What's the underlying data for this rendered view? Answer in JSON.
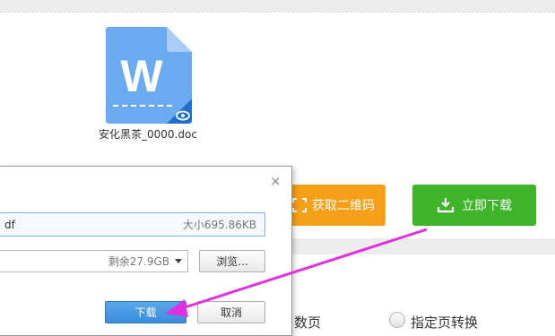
{
  "file": {
    "name": "安化黑茶_0000.doc",
    "icon_letter": "W"
  },
  "actions": {
    "qr_label": "获取二维码",
    "download_label": "立即下载"
  },
  "options": {
    "option1_label": "数页",
    "option2_label": "指定页转换"
  },
  "dialog": {
    "filename_partial": "df",
    "size_text": "大小695.86KB",
    "space_text": "剩余27.9GB",
    "browse_label": "浏览...",
    "download_label": "下载",
    "cancel_label": "取消",
    "close_glyph": "×"
  },
  "colors": {
    "qr_orange": "#f6a01a",
    "download_green": "#3fb42b",
    "word_blue": "#6aaaf0",
    "arrow_magenta": "#e030e0"
  }
}
